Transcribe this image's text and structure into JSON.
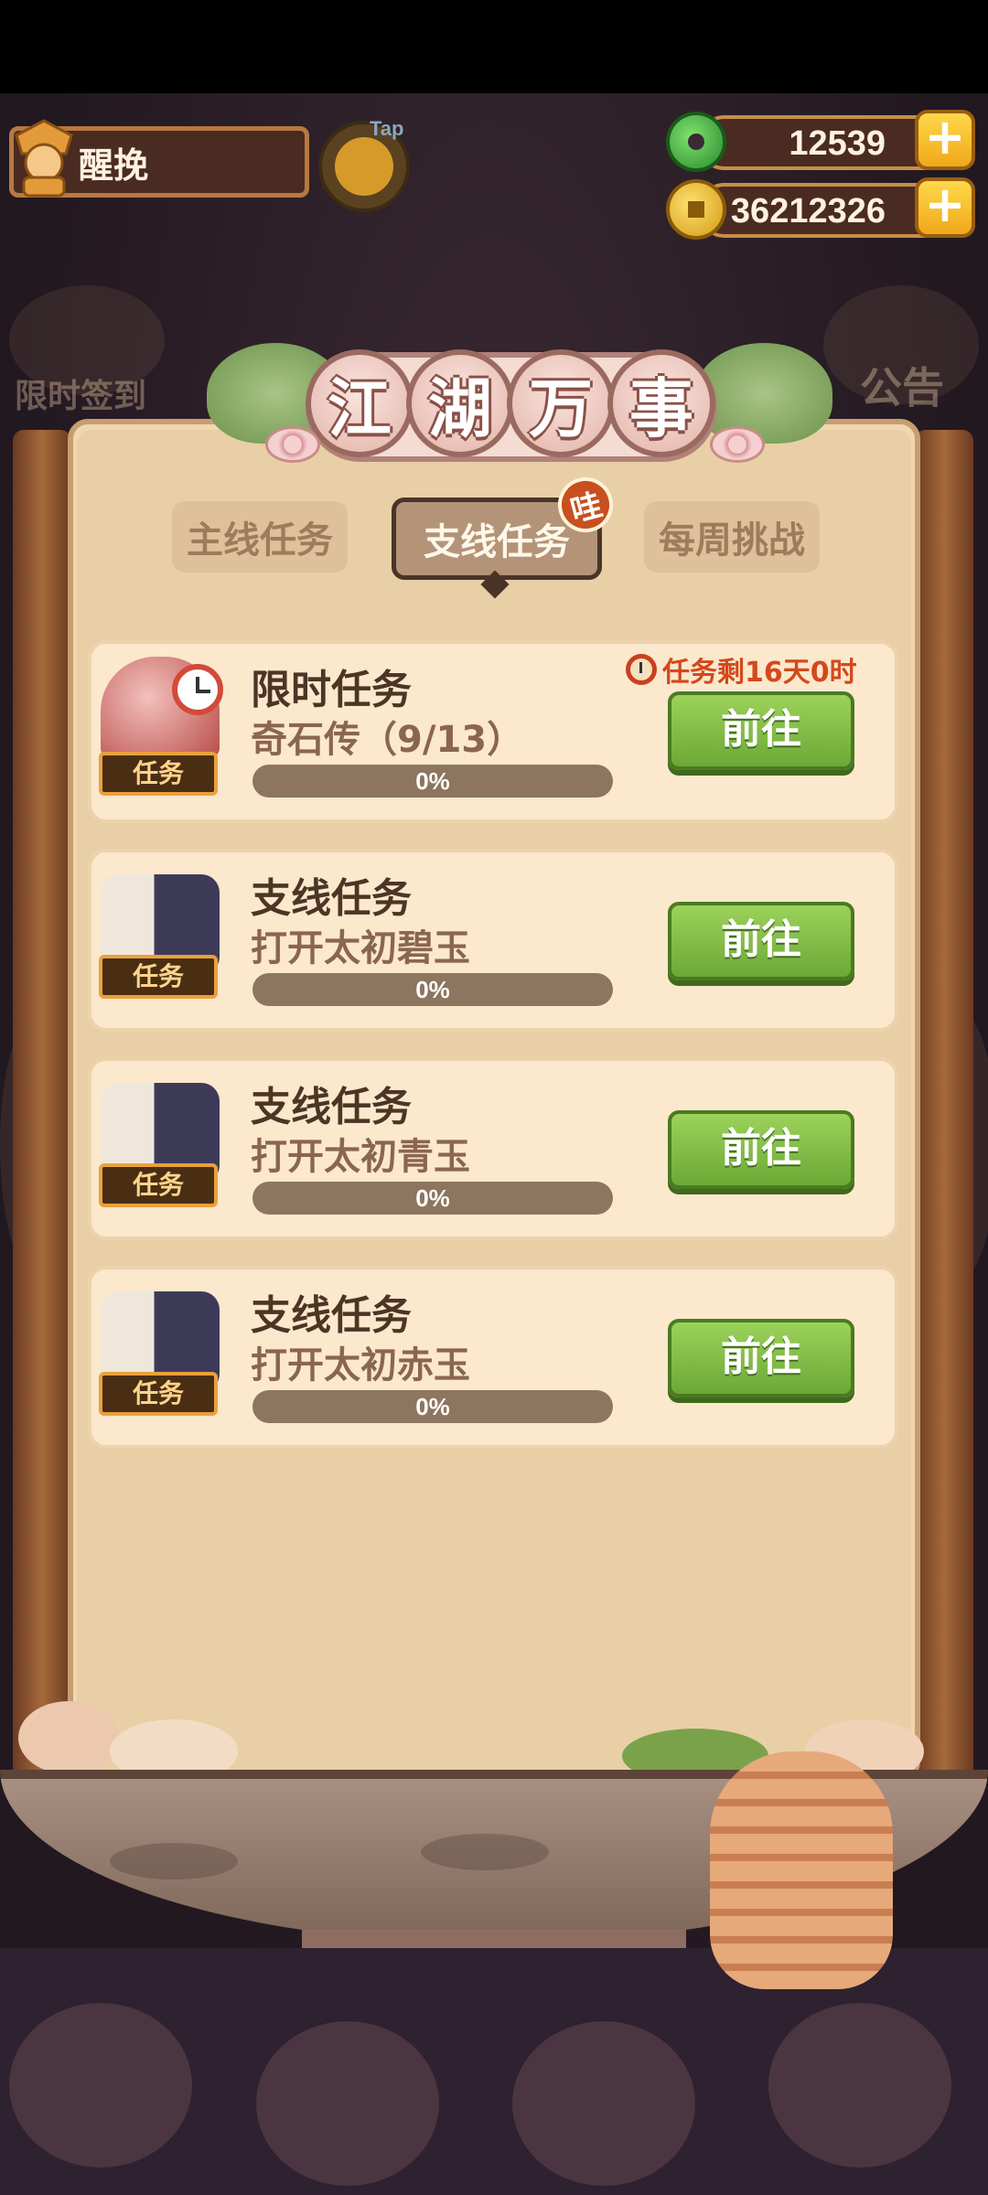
{
  "player": {
    "name": "醒挽",
    "tap_label": "Tap"
  },
  "currency": {
    "jade": {
      "value": "12539",
      "plus_label": "+"
    },
    "coins": {
      "value": "36212326",
      "plus_label": "+"
    }
  },
  "background_labels": {
    "left_signin": "限时签到",
    "right_notice": "公告"
  },
  "panel": {
    "title_chars": [
      "江",
      "湖",
      "万",
      "事"
    ],
    "tabs": [
      {
        "label": "主线任务",
        "active": false
      },
      {
        "label": "支线任务",
        "active": true
      },
      {
        "label": "每周挑战",
        "active": false
      }
    ],
    "active_tab_badge": "哇",
    "timer_text": "任务剩16天0时",
    "tasks": [
      {
        "tag": "任务",
        "title": "限时任务",
        "desc": "奇石传（9/13）",
        "progress": 0,
        "progress_label": "0%",
        "button": "前往"
      },
      {
        "tag": "任务",
        "title": "支线任务",
        "desc": "打开太初碧玉",
        "progress": 0,
        "progress_label": "0%",
        "button": "前往"
      },
      {
        "tag": "任务",
        "title": "支线任务",
        "desc": "打开太初青玉",
        "progress": 0,
        "progress_label": "0%",
        "button": "前往"
      },
      {
        "tag": "任务",
        "title": "支线任务",
        "desc": "打开太初赤玉",
        "progress": 0,
        "progress_label": "0%",
        "button": "前往"
      }
    ]
  },
  "colors": {
    "button_green": "#6da836",
    "timer_red": "#d4481c",
    "panel_bg": "#e9cfa5"
  }
}
